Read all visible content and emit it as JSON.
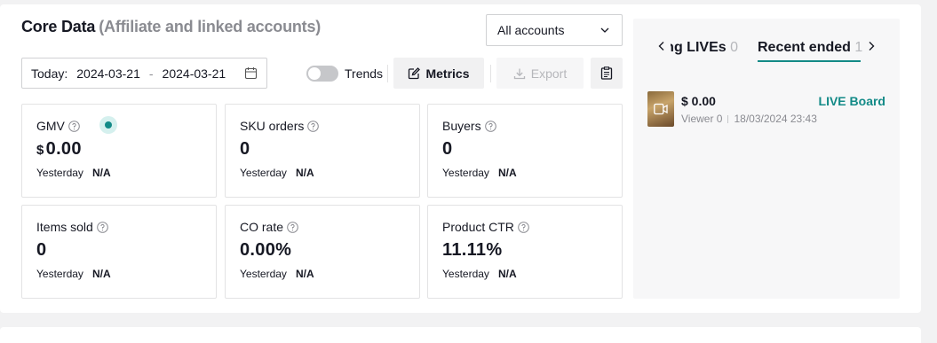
{
  "header": {
    "title": "Core Data",
    "subtitle": "(Affiliate and linked accounts)"
  },
  "account_select": {
    "value": "All accounts",
    "icon": "chevron-down-icon"
  },
  "date_range": {
    "label": "Today:",
    "start": "2024-03-21",
    "separator": "-",
    "end": "2024-03-21",
    "icon": "calendar-icon"
  },
  "toolbar": {
    "trends_label": "Trends",
    "trends_enabled": false,
    "metrics_label": "Metrics",
    "export_label": "Export",
    "export_disabled": true
  },
  "metrics": [
    {
      "name": "GMV",
      "currency": "$",
      "value": "0.00",
      "compare_label": "Yesterday",
      "compare_value": "N/A"
    },
    {
      "name": "SKU orders",
      "value": "0",
      "compare_label": "Yesterday",
      "compare_value": "N/A"
    },
    {
      "name": "Buyers",
      "value": "0",
      "compare_label": "Yesterday",
      "compare_value": "N/A"
    },
    {
      "name": "Items sold",
      "value": "0",
      "compare_label": "Yesterday",
      "compare_value": "N/A"
    },
    {
      "name": "CO rate",
      "value": "0.00%",
      "compare_label": "Yesterday",
      "compare_value": "N/A"
    },
    {
      "name": "Product CTR",
      "value": "11.11%",
      "compare_label": "Yesterday",
      "compare_value": "N/A"
    }
  ],
  "live_panel": {
    "tabs": [
      {
        "label": "Ongoing LIVEs",
        "count": "0",
        "active": false
      },
      {
        "label": "Recent ended",
        "count": "1",
        "active": true
      }
    ],
    "items": [
      {
        "price": "$ 0.00",
        "viewer": "Viewer 0",
        "datetime": "18/03/2024 23:43",
        "action": "LIVE Board"
      }
    ]
  },
  "colors": {
    "accent": "#138a87",
    "text": "#161823",
    "muted": "#8a8b91",
    "border": "#e3e3e4"
  }
}
